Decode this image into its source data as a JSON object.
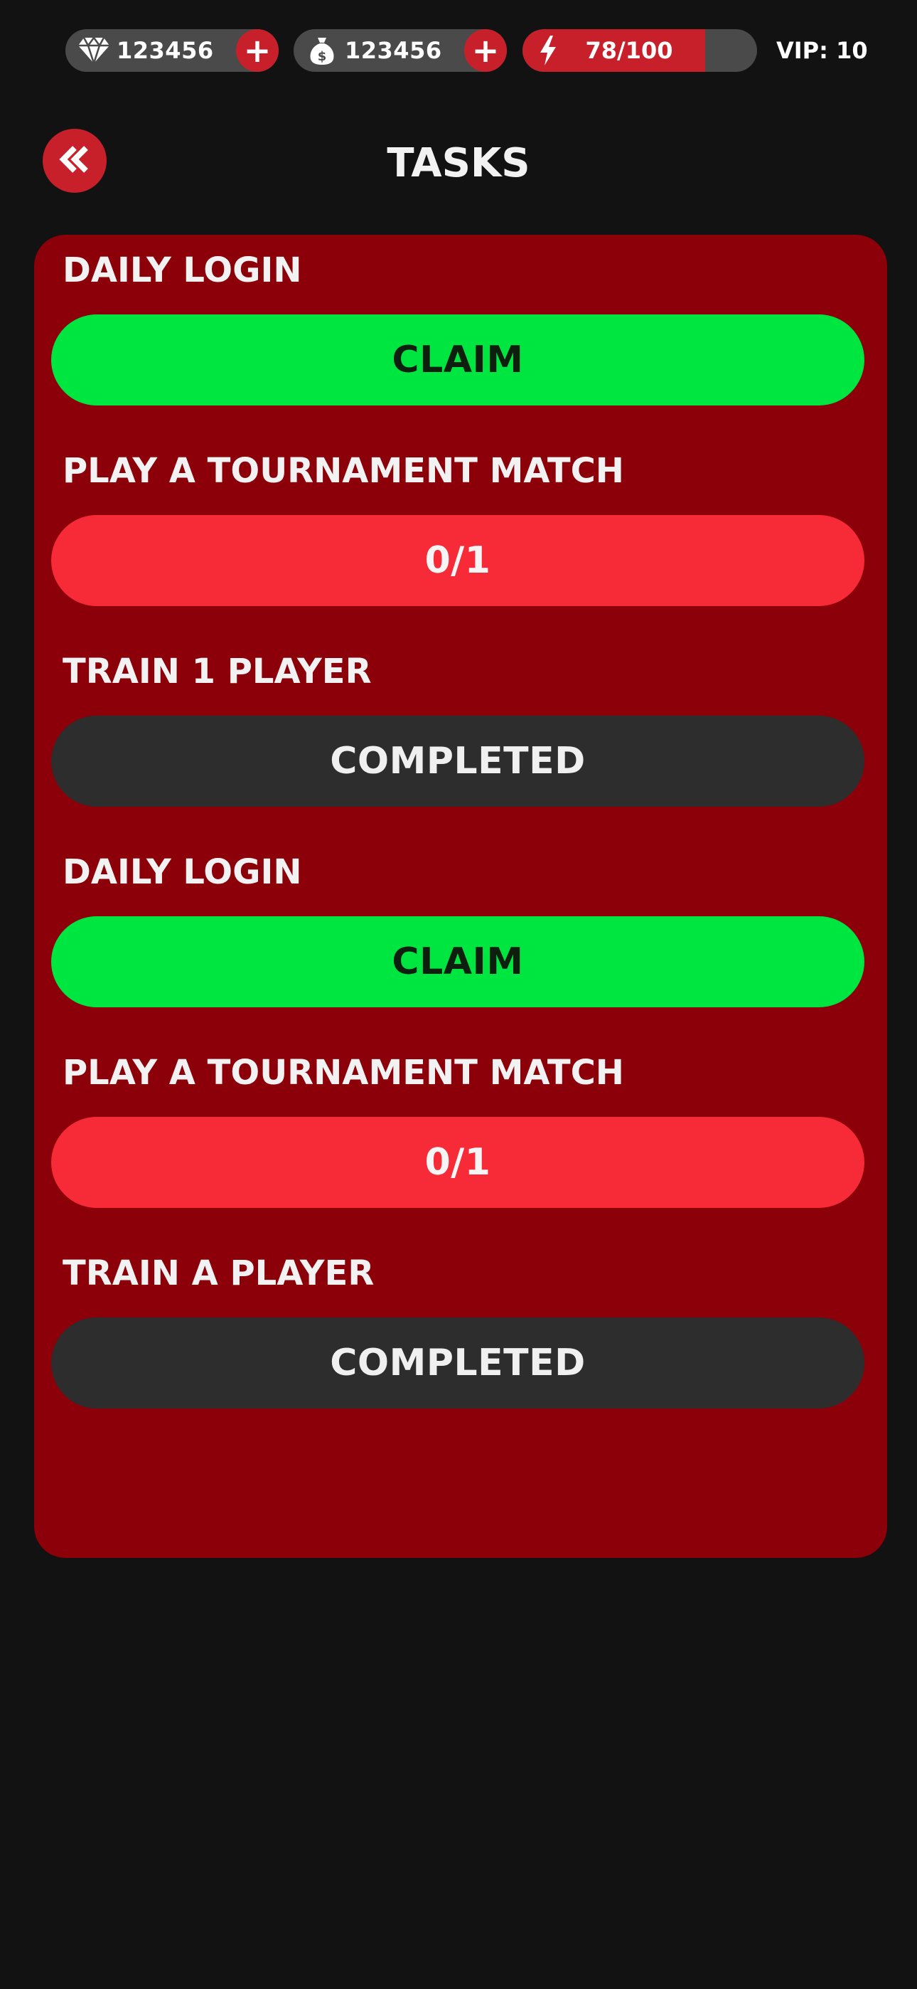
{
  "topbar": {
    "gems": {
      "value": "123456",
      "icon": "diamond-icon",
      "add_label": "+"
    },
    "cash": {
      "value": "123456",
      "icon": "money-bag-icon",
      "add_label": "+"
    },
    "energy": {
      "text": "78/100",
      "current": 78,
      "max": 100,
      "icon": "lightning-icon"
    },
    "vip": "VIP: 10"
  },
  "header": {
    "back_label": "«",
    "title": "TASKS"
  },
  "colors": {
    "accent_red": "#c8202a",
    "panel_red": "#8b0009",
    "claim_green": "#00e640",
    "progress_red": "#f72a38",
    "completed_gray": "#2d2d2d",
    "background": "#121212"
  },
  "tasks": [
    {
      "title": "DAILY LOGIN",
      "action": "CLAIM",
      "state": "claim"
    },
    {
      "title": "PLAY A TOURNAMENT MATCH",
      "action": "0/1",
      "state": "progress"
    },
    {
      "title": "TRAIN 1 PLAYER",
      "action": "COMPLETED",
      "state": "completed"
    },
    {
      "title": "DAILY LOGIN",
      "action": "CLAIM",
      "state": "claim"
    },
    {
      "title": "PLAY A TOURNAMENT MATCH",
      "action": "0/1",
      "state": "progress"
    },
    {
      "title": "TRAIN A PLAYER",
      "action": "COMPLETED",
      "state": "completed"
    }
  ]
}
